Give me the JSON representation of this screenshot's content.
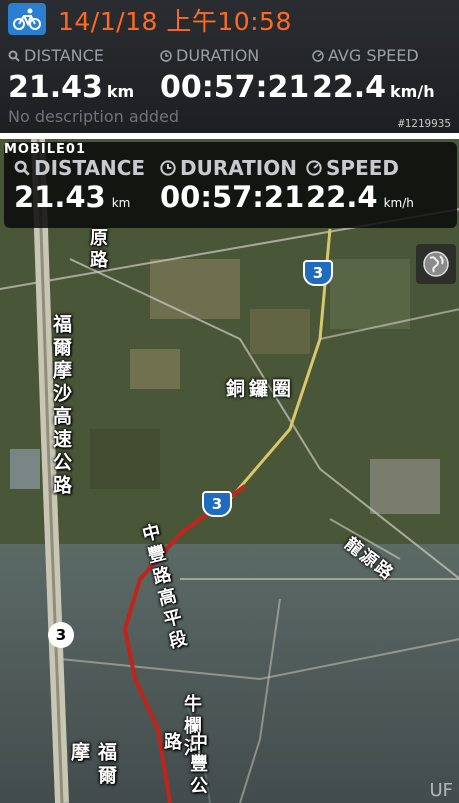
{
  "header": {
    "datetime": "14/1/18 上午10:58",
    "stats": [
      {
        "label": "DISTANCE",
        "value": "21.43",
        "unit": "km"
      },
      {
        "label": "DURATION",
        "value": "00:57:21",
        "unit": ""
      },
      {
        "label": "AVG SPEED",
        "value": "22.4",
        "unit": "km/h"
      }
    ],
    "description_placeholder": "No description added",
    "post_id": "#1219935"
  },
  "map_overlay": {
    "brand": "MOBILE01",
    "stats": [
      {
        "label": "DISTANCE",
        "value": "21.43",
        "unit": "km"
      },
      {
        "label": "DURATION",
        "value": "00:57:21",
        "unit": ""
      },
      {
        "label": "SPEED",
        "value": "22.4",
        "unit": "km/h"
      }
    ]
  },
  "map": {
    "labels": {
      "road_top": "原路",
      "highway": "福爾摩沙高速公路",
      "town": "銅鑼圈",
      "longyuan": "龍源路",
      "zhongfeng3": "中豐路高平段",
      "river": "牛欄河",
      "zhongfeng_bottom": "中豐公路",
      "highway_bottom": "福爾摩"
    },
    "shields": {
      "route3_a": "3",
      "route3_b": "3",
      "route3_c": "3"
    },
    "watermark": "UF"
  },
  "colors": {
    "accent": "#ff6a21",
    "route": "#c0241c",
    "bike_bg": "#2b7fd1"
  },
  "icons": {
    "activity": "bike-icon",
    "distance": "search-icon",
    "duration": "clock-icon",
    "speed": "gauge-icon",
    "layers": "globe-icon"
  }
}
